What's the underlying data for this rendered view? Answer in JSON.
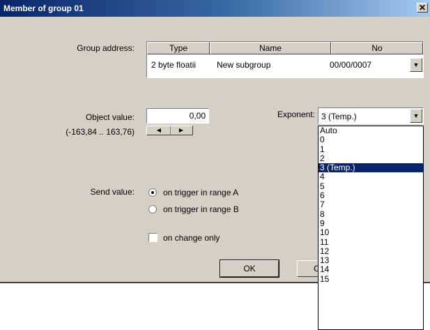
{
  "dialog": {
    "title": "Member of group 01",
    "close_glyph": "✕"
  },
  "group_address": {
    "label": "Group address:",
    "columns": [
      "Type",
      "Name",
      "No"
    ],
    "row": {
      "type": "2 byte floatii",
      "name": "New subgroup",
      "no": "00/00/0007"
    }
  },
  "object_value": {
    "label": "Object value:",
    "value": "0,00",
    "range": "(-163,84 .. 163,76)"
  },
  "exponent": {
    "label": "Exponent:",
    "selected": "3 (Temp.)",
    "options": [
      "Auto",
      "0",
      "1",
      "2",
      "3 (Temp.)",
      "4",
      "5",
      "6",
      "7",
      "8",
      "9",
      "10",
      "11",
      "12",
      "13",
      "14",
      "15"
    ],
    "selected_index": 4
  },
  "send_value": {
    "label": "Send value:",
    "options": [
      {
        "label": "on trigger in range A",
        "checked": true
      },
      {
        "label": "on trigger in range B",
        "checked": false
      }
    ],
    "on_change_label": "on change only",
    "on_change_checked": false
  },
  "buttons": {
    "ok": "OK",
    "cancel_partial": "C"
  }
}
